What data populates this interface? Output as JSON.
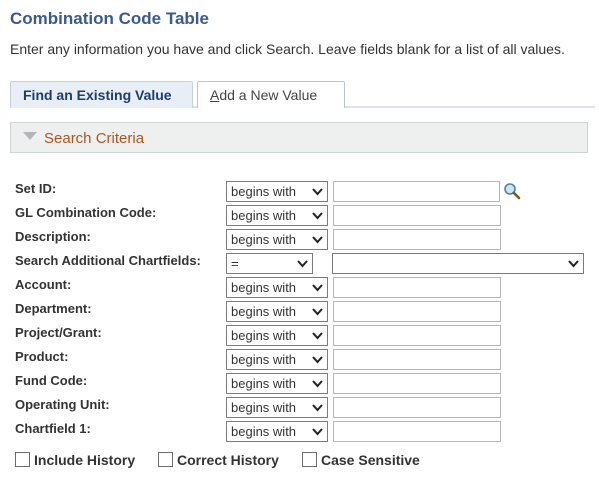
{
  "page": {
    "title": "Combination Code Table",
    "instructions": "Enter any information you have and click Search. Leave fields blank for a list of all values."
  },
  "tabs": {
    "find_label": "Find an Existing Value",
    "add_label_prefix": "A",
    "add_label_rest": "dd a New Value"
  },
  "search_criteria": {
    "label": "Search Criteria"
  },
  "fields": [
    {
      "label": "Set ID:",
      "operator": "begins with",
      "value": ""
    },
    {
      "label": "GL Combination Code:",
      "operator": "begins with",
      "value": ""
    },
    {
      "label": "Description:",
      "operator": "begins with",
      "value": ""
    },
    {
      "label": "Search Additional Chartfields:",
      "operator": "=",
      "value": ""
    },
    {
      "label": "Account:",
      "operator": "begins with",
      "value": ""
    },
    {
      "label": "Department:",
      "operator": "begins with",
      "value": ""
    },
    {
      "label": "Project/Grant:",
      "operator": "begins with",
      "value": ""
    },
    {
      "label": "Product:",
      "operator": "begins with",
      "value": ""
    },
    {
      "label": "Fund Code:",
      "operator": "begins with",
      "value": ""
    },
    {
      "label": "Operating Unit:",
      "operator": "begins with",
      "value": ""
    },
    {
      "label": "Chartfield 1:",
      "operator": "begins with",
      "value": ""
    }
  ],
  "checkboxes": [
    {
      "label": "Include History",
      "checked": false
    },
    {
      "label": "Correct History",
      "checked": false
    },
    {
      "label": "Case Sensitive",
      "checked": false
    }
  ],
  "colors": {
    "title": "#3b5a8b",
    "criteria_label": "#b0551c",
    "active_tab_bg": "#e8eef6"
  }
}
